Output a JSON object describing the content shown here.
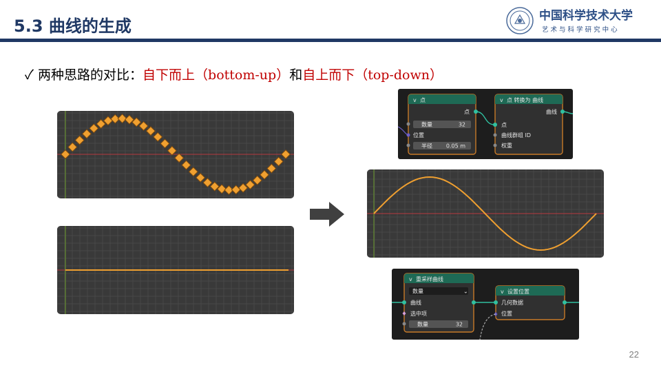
{
  "header": {
    "title": "5.3 曲线的生成",
    "logo_main": "中国科学技术大学",
    "logo_sub": "艺 术 与 科 学 研 究 中 心"
  },
  "bullet": {
    "check": "✓",
    "prefix": "两种思路的对比：",
    "bottom_up": "自下而上（bottom-up）",
    "mid": "和",
    "top_down": "自上而下（top-down）"
  },
  "node_tree_a": {
    "node_point": {
      "title": "点",
      "output": "点",
      "rows": [
        {
          "label": "数量",
          "value": "32"
        },
        {
          "label": "位置"
        },
        {
          "label": "半径",
          "value": "0.05 m"
        }
      ]
    },
    "node_convert": {
      "title": "点 转换为 曲线",
      "output": "曲线",
      "rows": [
        {
          "label": "点"
        },
        {
          "label": "曲线群组 ID"
        },
        {
          "label": "权重"
        }
      ]
    }
  },
  "node_tree_b": {
    "node_resample": {
      "title": "重采样曲线",
      "mode": "数量",
      "rows": [
        {
          "label": "曲线"
        },
        {
          "label": "选中项"
        },
        {
          "label": "数量",
          "value": "32"
        }
      ]
    },
    "node_setpos": {
      "title": "设置位置",
      "rows": [
        {
          "label": "几何数据"
        },
        {
          "label": "位置"
        }
      ]
    }
  },
  "page": {
    "number": "22"
  },
  "colors": {
    "header_blue": "#1f3864",
    "accent_red": "#c00000",
    "curve_orange": "#f0a030",
    "node_green": "#1e6a55"
  }
}
